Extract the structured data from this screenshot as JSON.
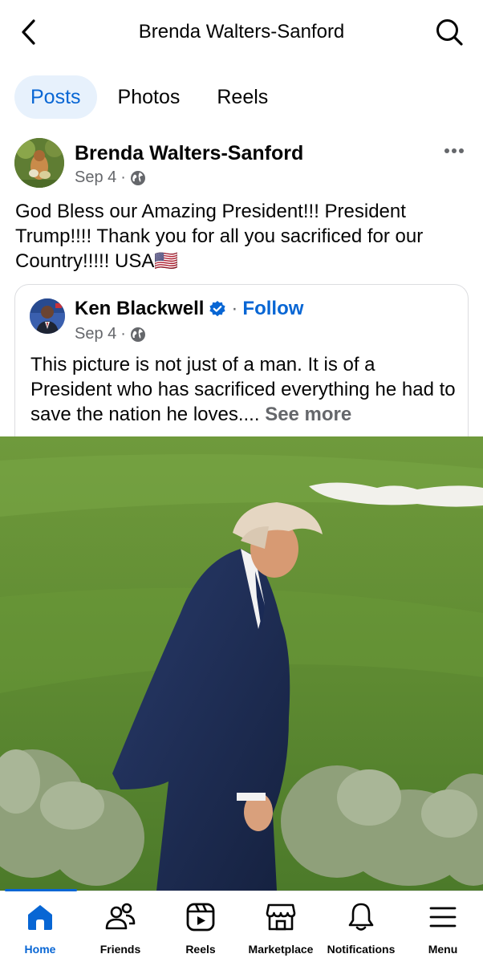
{
  "header": {
    "title": "Brenda Walters-Sanford",
    "back_icon": "chevron-left-icon",
    "search_icon": "search-icon"
  },
  "tabs": [
    {
      "label": "Posts",
      "active": true
    },
    {
      "label": "Photos",
      "active": false
    },
    {
      "label": "Reels",
      "active": false
    }
  ],
  "post": {
    "author": "Brenda Walters-Sanford",
    "date": "Sep 4",
    "separator": "·",
    "audience_icon": "globe-icon",
    "text": "God Bless our Amazing President!!! President Trump!!!! Thank you for all you sacrificed for our Country!!!!! USA🇺🇸",
    "more_icon": "more-horizontal-icon"
  },
  "shared": {
    "author": "Ken Blackwell",
    "verified_icon": "verified-badge-icon",
    "separator": "·",
    "follow_label": "Follow",
    "date": "Sep 4",
    "meta_separator": "·",
    "audience_icon": "globe-icon",
    "text": "This picture is not just of a man. It is of a President who has sacrificed everything he had to save the nation he loves....",
    "see_more": "See more"
  },
  "photo": {
    "subject": "man-in-navy-suit-on-golf-course-image"
  },
  "bottom_nav": [
    {
      "label": "Home",
      "icon": "home-icon",
      "active": true
    },
    {
      "label": "Friends",
      "icon": "friends-icon",
      "active": false
    },
    {
      "label": "Reels",
      "icon": "reels-icon",
      "active": false
    },
    {
      "label": "Marketplace",
      "icon": "marketplace-icon",
      "active": false
    },
    {
      "label": "Notifications",
      "icon": "bell-icon",
      "active": false
    },
    {
      "label": "Menu",
      "icon": "menu-icon",
      "active": false
    }
  ],
  "colors": {
    "accent": "#0866d4",
    "tab_active_bg": "#e7f1fc",
    "secondary_text": "#65676b",
    "verified": "#0866d4"
  }
}
